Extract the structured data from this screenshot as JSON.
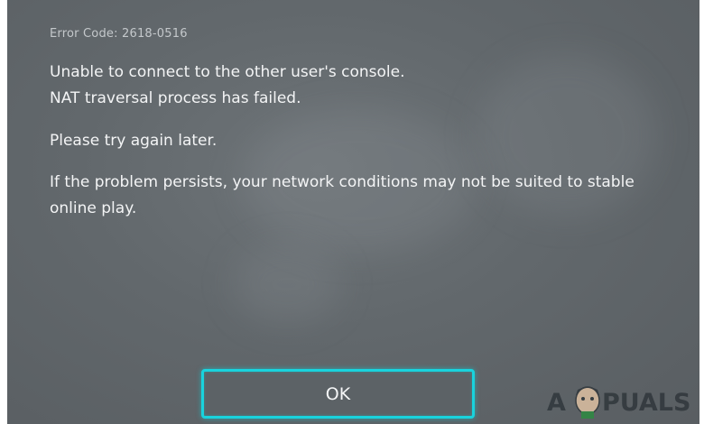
{
  "dialog": {
    "error_code": "Error Code: 2618-0516",
    "line1": "Unable to connect to the other user's console.",
    "line2": "NAT traversal process has failed.",
    "line3": "Please try again later.",
    "line4": "If the problem persists, your network conditions may not be suited to stable",
    "line5": "online play."
  },
  "button": {
    "ok_label": "OK"
  },
  "watermark": {
    "text": "APPUALS",
    "left_letter": "A",
    "right_letters": "PUALS"
  },
  "colors": {
    "background": "#62686c",
    "text": "#f3f4f5",
    "error_code_text": "#c4c8cb",
    "button_highlight": "#19d3dd"
  }
}
